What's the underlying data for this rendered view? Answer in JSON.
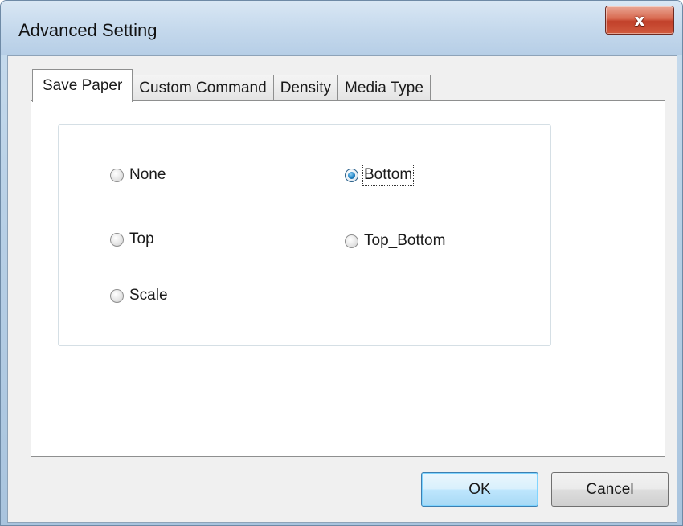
{
  "window": {
    "title": "Advanced Setting",
    "close_glyph": "x"
  },
  "tabs": [
    {
      "label": "Save Paper",
      "active": true
    },
    {
      "label": "Custom Command",
      "active": false
    },
    {
      "label": "Density",
      "active": false
    },
    {
      "label": "Media Type",
      "active": false
    }
  ],
  "save_paper": {
    "options": [
      {
        "label": "None",
        "checked": false
      },
      {
        "label": "Bottom",
        "checked": true
      },
      {
        "label": "Top",
        "checked": false
      },
      {
        "label": "Top_Bottom",
        "checked": false
      },
      {
        "label": "Scale",
        "checked": false
      }
    ]
  },
  "buttons": {
    "ok": "OK",
    "cancel": "Cancel"
  },
  "colors": {
    "close_button": "#c1402a",
    "radio_selected": "#1b80c2",
    "default_button_border": "#3c7fb1"
  }
}
